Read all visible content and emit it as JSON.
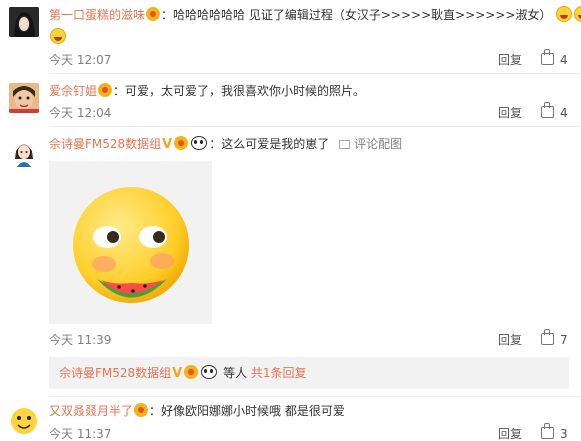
{
  "comments": [
    {
      "username": "第一口蛋糕的滋味",
      "text": "哈哈哈哈哈哈 见证了编辑过程（女汉子>>>>>耿直>>>>>>淑女）",
      "time": "今天 12:07",
      "reply": "回复",
      "likes": "4",
      "avatar_icon": "avatar-dark-hair"
    },
    {
      "username": "爱佘钉姐",
      "text": "可爱，太可爱了，我很喜欢你小时候的照片。",
      "time": "今天 12:04",
      "reply": "回复",
      "likes": "4",
      "avatar_icon": "avatar-child"
    },
    {
      "username": "佘诗曼FM528数据组",
      "text": "这么可爱是我的崽了",
      "pic_label": "评论配图",
      "time": "今天 11:39",
      "reply": "回复",
      "likes": "7",
      "avatar_icon": "avatar-cartoon",
      "image_icon": "watermelon-emoji-image"
    },
    {
      "username": "又双叒叕月半了",
      "text": "好像欧阳娜娜小时候哦  都是很可爱",
      "time": "今天 11:37",
      "reply": "回复",
      "likes": "3",
      "avatar_icon": "avatar-yellow-emoji"
    }
  ],
  "sub_reply": {
    "username": "佘诗曼FM528数据组",
    "suffix": "等人",
    "count_link": "共1条回复"
  },
  "colors": {
    "username": "#eb7350",
    "time": "#808080",
    "badge": "#f5b21b",
    "reply_bg": "#f2f2f2"
  }
}
